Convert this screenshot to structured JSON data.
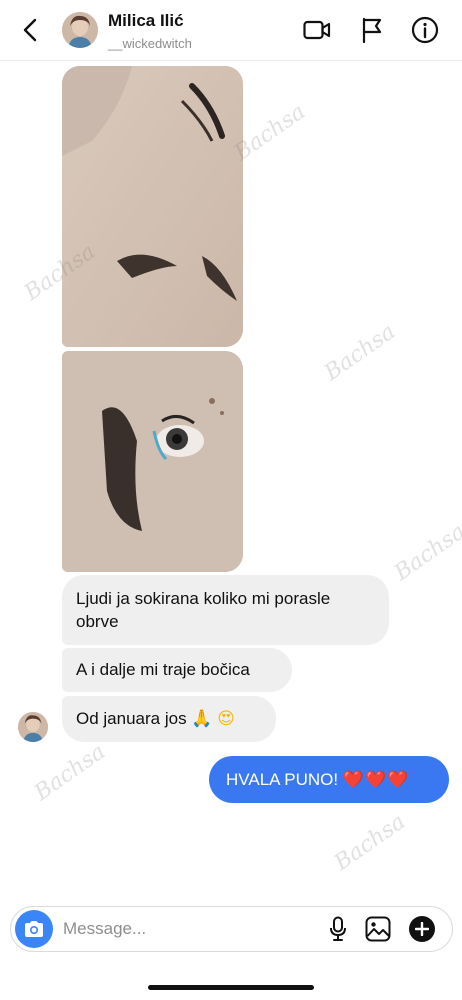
{
  "header": {
    "name": "Milica Ilić",
    "handle": "__wickedwitch",
    "icons": [
      "back-chevron-icon",
      "video-camera-icon",
      "flag-icon",
      "info-icon"
    ]
  },
  "photos": [
    {
      "alt": "eyebrows photo",
      "kind": "photo"
    },
    {
      "alt": "eye closeup photo",
      "kind": "photo"
    }
  ],
  "messages": {
    "received": [
      {
        "text": "Ljudi ja sokirana koliko mi porasle obrve"
      },
      {
        "text": "A i dalje mi traje bočica"
      },
      {
        "text": "Od januara jos",
        "emoji": [
          "🙏",
          "😍"
        ]
      }
    ],
    "sent": [
      {
        "text": "HVALA PUNO!",
        "emoji": "❤️❤️❤️"
      }
    ]
  },
  "composer": {
    "placeholder": "Message...",
    "icons": [
      "camera-icon",
      "microphone-icon",
      "gallery-icon",
      "plus-icon"
    ]
  },
  "watermark": {
    "text": "Bachsa"
  },
  "colors": {
    "sent_bubble": "#3a78f2",
    "received_bubble": "#efefef",
    "camera_button": "#3a86f5"
  }
}
